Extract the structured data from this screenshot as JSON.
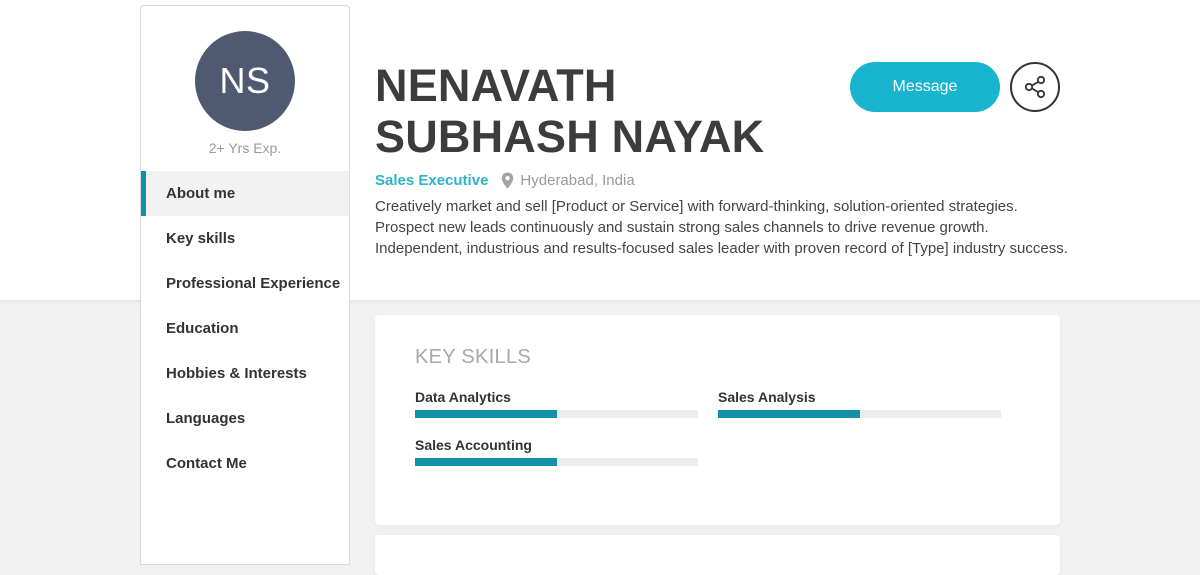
{
  "profile": {
    "initials": "NS",
    "experience": "2+ Yrs Exp.",
    "name": "NENAVATH SUBHASH NAYAK",
    "role": "Sales Executive",
    "location": "Hyderabad, India",
    "summary": "Creatively market and sell [Product or Service] with forward-thinking, solution-oriented strategies. Prospect new leads continuously and sustain strong sales channels to drive revenue growth. Independent, industrious and results-focused sales leader with proven record of [Type] industry success."
  },
  "actions": {
    "message_label": "Message",
    "share_icon": "share-icon"
  },
  "nav": {
    "items": [
      {
        "label": "About me",
        "active": true
      },
      {
        "label": "Key skills"
      },
      {
        "label": "Professional Experience"
      },
      {
        "label": "Education"
      },
      {
        "label": "Hobbies & Interests"
      },
      {
        "label": "Languages"
      },
      {
        "label": "Contact Me"
      }
    ]
  },
  "skills_card": {
    "title": "KEY SKILLS",
    "skills": [
      {
        "name": "Data Analytics",
        "level": 0.5
      },
      {
        "name": "Sales Analysis",
        "level": 0.5
      },
      {
        "name": "Sales Accounting",
        "level": 0.5
      }
    ]
  },
  "colors": {
    "accent": "#1190a6",
    "button": "#17b3cf",
    "avatar": "#4f5a72",
    "role": "#2cb3c8"
  }
}
